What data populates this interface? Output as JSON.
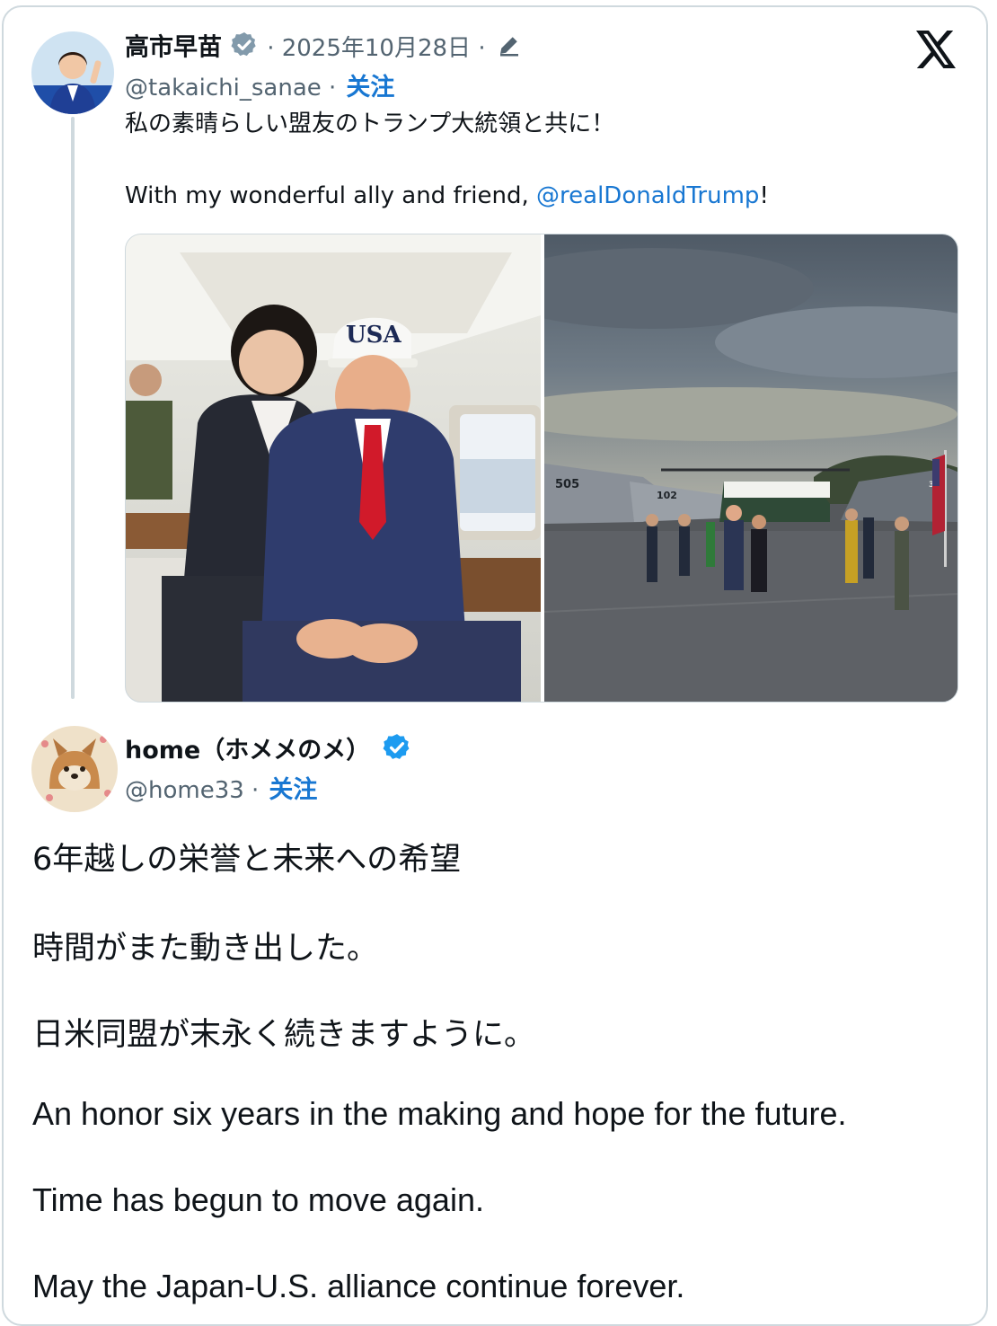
{
  "original_post": {
    "author_name": "高市早苗",
    "date_line": "· 2025年10月28日 ·",
    "handle_line": "@takaichi_sanae ·",
    "follow_label": "关注",
    "text_jp": "私の素晴らしい盟友のトランプ大統領と共に！",
    "text_en_prefix": "With my wonderful ally and friend, ",
    "text_en_mention": "@realDonaldTrump",
    "text_en_suffix": "!",
    "media": {
      "left_image_cap_text": "USA",
      "right_image_jet_numbers": [
        "505",
        "102",
        "315"
      ]
    }
  },
  "quote_post": {
    "author_name": "home（ホメメのメ）",
    "handle_line": "@home33 ·",
    "follow_label": "关注",
    "lines": [
      "6年越しの栄誉と未来への希望",
      "時間がまた動き出した。",
      "日米同盟が末永く続きますように。",
      "An honor six years in the making and hope for the future.",
      "Time has begun to move again.",
      "May the Japan-U.S. alliance continue forever."
    ]
  },
  "icons": {
    "verified_gray": "verified-badge-gray",
    "verified_blue": "verified-badge-blue",
    "edit": "pencil-icon",
    "x_logo": "x-logo"
  },
  "colors": {
    "link": "#1877d2",
    "muted": "#536471",
    "border": "#cfd9de",
    "verified_blue": "#1d9bf0",
    "verified_gray": "#829aab"
  }
}
